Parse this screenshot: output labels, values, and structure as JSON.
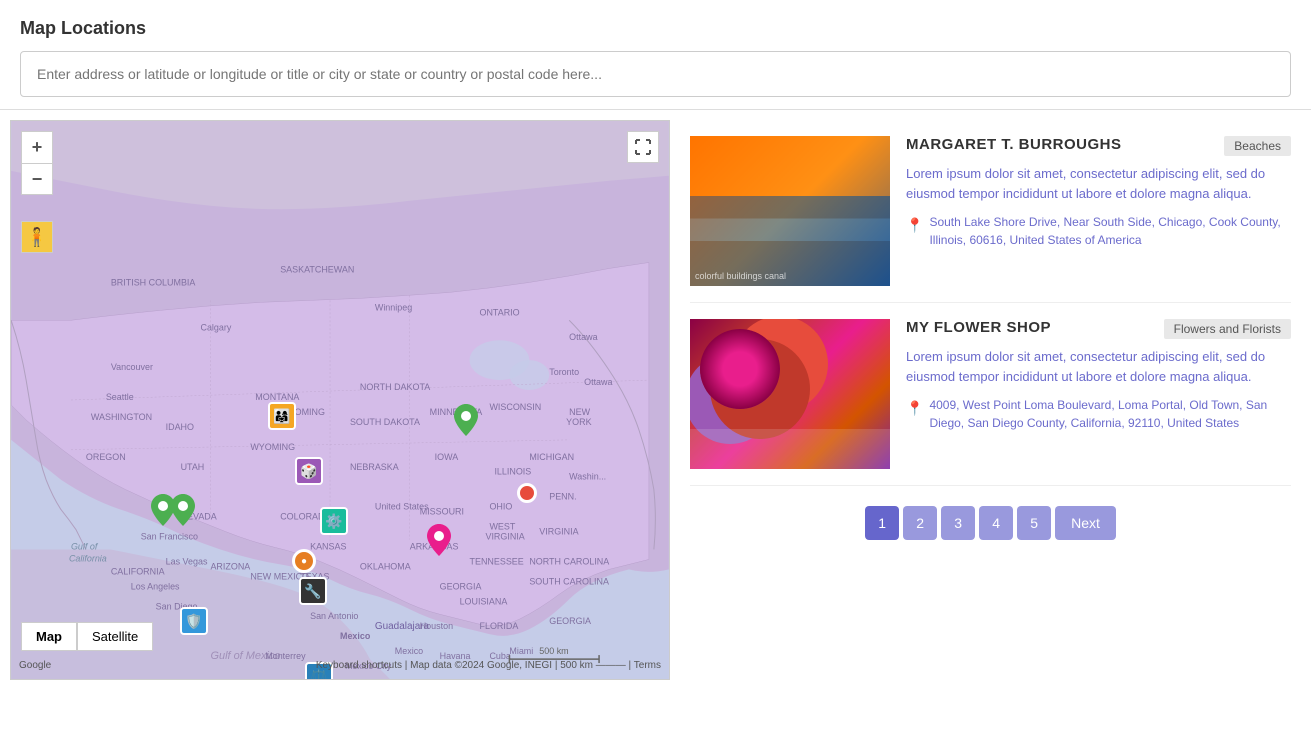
{
  "header": {
    "title": "Map Locations",
    "search_placeholder": "Enter address or latitude or longitude or title or city or state or country or postal code here..."
  },
  "map": {
    "zoom_in": "+",
    "zoom_out": "−",
    "fullscreen_icon": "⤢",
    "type_map": "Map",
    "type_satellite": "Satellite",
    "attribution": "Google",
    "attribution_data": "Map data ©2024 Google, INEGI",
    "scale": "500 km",
    "keyboard": "Keyboard shortcuts",
    "terms": "Terms"
  },
  "listings": [
    {
      "title": "MARGARET T. BURROUGHS",
      "badge": "Beaches",
      "description": "Lorem ipsum dolor sit amet, consectetur adipiscing elit, sed do eiusmod tempor incididunt ut labore et dolore magna aliqua.",
      "address": "South Lake Shore Drive, Near South Side, Chicago, Cook County, Illinois, 60616, United States of America",
      "image_type": "buildings"
    },
    {
      "title": "MY FLOWER SHOP",
      "badge": "Flowers and Florists",
      "description": "Lorem ipsum dolor sit amet, consectetur adipiscing elit, sed do eiusmod tempor incididunt ut labore et dolore magna aliqua.",
      "address": "4009, West Point Loma Boulevard, Loma Portal, Old Town, San Diego, San Diego County, California, 92110, United States",
      "image_type": "flowers"
    }
  ],
  "pagination": {
    "pages": [
      "1",
      "2",
      "3",
      "4",
      "5"
    ],
    "active_page": 0,
    "next_label": "Next"
  }
}
